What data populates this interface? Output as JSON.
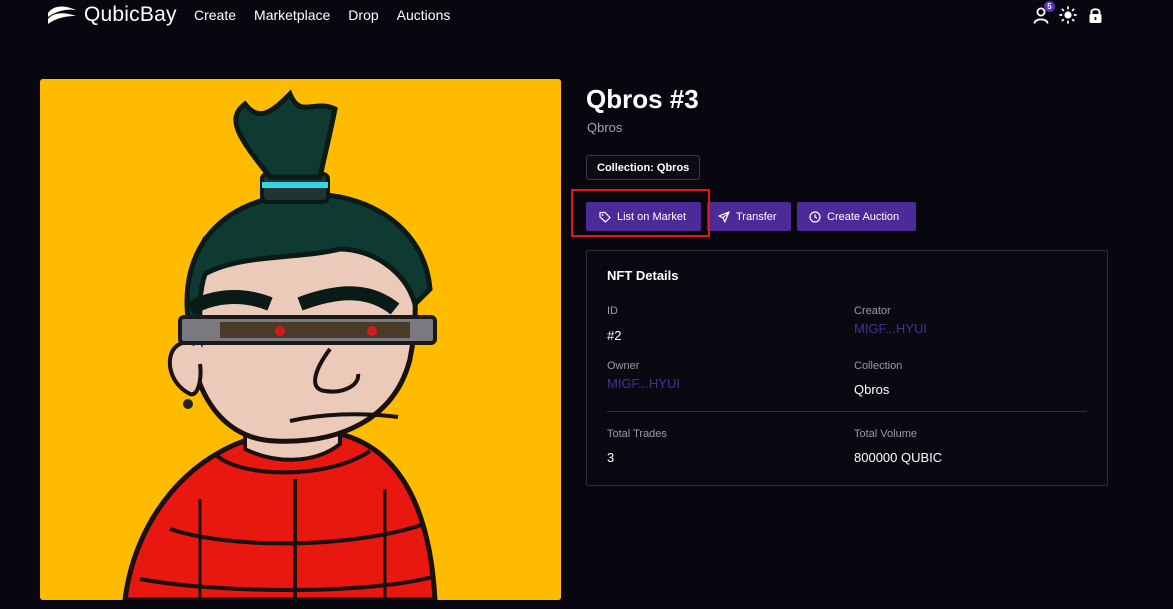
{
  "nav": {
    "brand": "QubicBay",
    "links": [
      "Create",
      "Marketplace",
      "Drop",
      "Auctions"
    ],
    "notification_count": "5",
    "icons": [
      "user-icon",
      "sun-icon",
      "lock-icon"
    ]
  },
  "nft": {
    "title": "Qbros #3",
    "subtitle": "Qbros",
    "collection_tag": "Collection: Qbros",
    "image_background": "#ffbb00"
  },
  "actions": {
    "list_on_market": "List on Market",
    "transfer": "Transfer",
    "create_auction": "Create Auction",
    "button_color": "#4c2a98"
  },
  "details": {
    "heading": "NFT Details",
    "id_label": "ID",
    "id_value": "#2",
    "creator_label": "Creator",
    "creator_value": "MIGF...HYUI",
    "owner_label": "Owner",
    "owner_value": "MIGF...HYUI",
    "collection_label": "Collection",
    "collection_value": "Qbros",
    "total_trades_label": "Total Trades",
    "total_trades_value": "3",
    "total_volume_label": "Total Volume",
    "total_volume_value": "800000 QUBIC"
  },
  "colors": {
    "background": "#08070f",
    "accent": "#4c2a98",
    "link": "#4b2e93",
    "highlight": "#e8141c"
  }
}
